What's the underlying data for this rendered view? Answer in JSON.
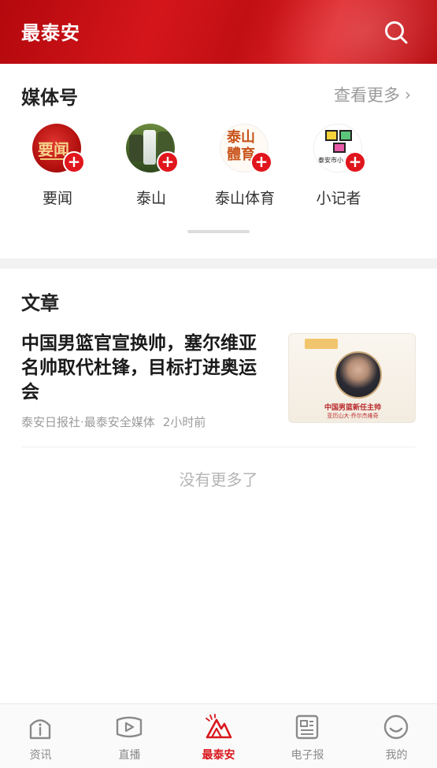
{
  "header": {
    "title": "最泰安",
    "search_icon": "search-icon"
  },
  "media": {
    "section_title": "媒体号",
    "more_label": "查看更多",
    "items": [
      {
        "name": "要闻",
        "avatar_text": "要闻"
      },
      {
        "name": "泰山",
        "avatar_text": ""
      },
      {
        "name": "泰山体育",
        "avatar_text": "泰山體育"
      },
      {
        "name": "小记者",
        "avatar_text": "泰安市小"
      }
    ],
    "follow_icon": "plus-icon"
  },
  "articles": {
    "section_title": "文章",
    "items": [
      {
        "headline": "中国男篮官宣换帅，塞尔维亚名帅取代杜锋，目标打进奥运会",
        "source": "泰安日报社·最泰安全媒体",
        "time": "2小时前",
        "thumb_caption": "中国男篮新任主帅",
        "thumb_subcaption": "亚历山大·乔尔杰维奇"
      }
    ],
    "end_text": "没有更多了"
  },
  "tabbar": {
    "tabs": [
      {
        "label": "资讯",
        "icon": "home-icon",
        "active": false
      },
      {
        "label": "直播",
        "icon": "live-play-icon",
        "active": false
      },
      {
        "label": "最泰安",
        "icon": "mountain-logo-icon",
        "active": true
      },
      {
        "label": "电子报",
        "icon": "newspaper-icon",
        "active": false
      },
      {
        "label": "我的",
        "icon": "smiley-profile-icon",
        "active": false
      }
    ]
  },
  "colors": {
    "brand_red": "#d4161b",
    "active_tab": "#d9161c",
    "inactive_tab": "#8a8a8a"
  }
}
